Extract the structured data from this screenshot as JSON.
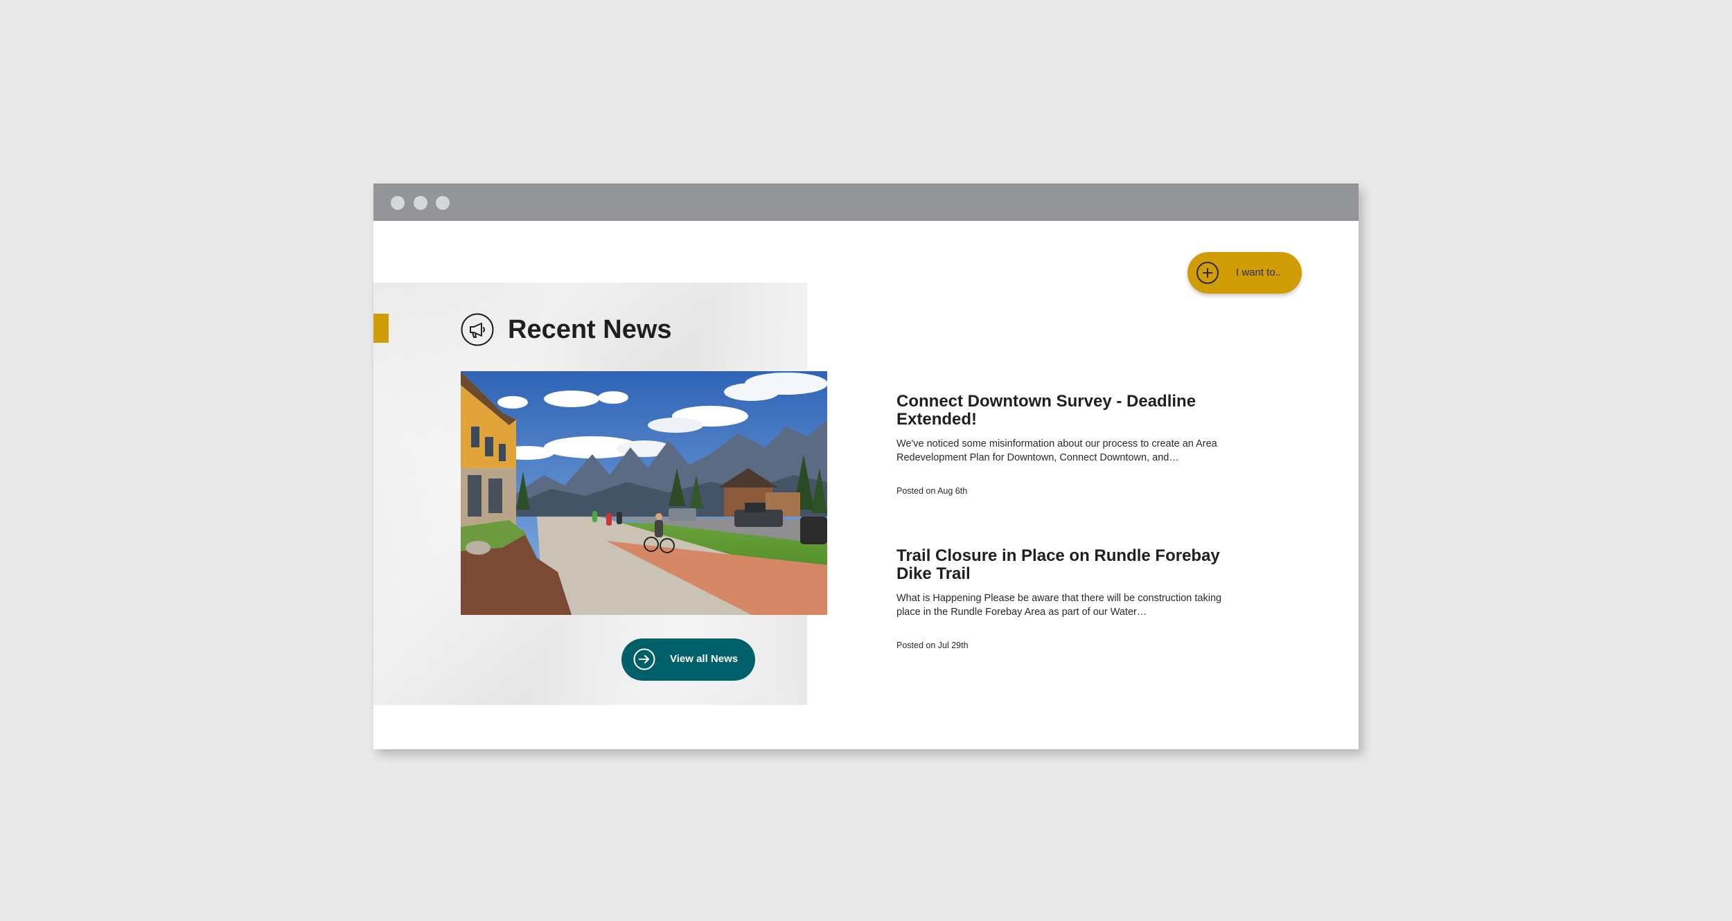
{
  "actions": {
    "want_label": "I want to.."
  },
  "news": {
    "section_title": "Recent News",
    "view_all_label": "View all News",
    "articles": [
      {
        "title": "Connect Downtown Survey - Deadline Extended!",
        "excerpt": "We've noticed some misinformation about our process to create an Area Redevelopment Plan for Downtown, Connect Downtown, and…",
        "date": "Posted on Aug 6th"
      },
      {
        "title": "Trail Closure in Place on Rundle Forebay Dike Trail",
        "excerpt": "What is Happening Please be aware that there will be construction taking place in the Rundle Forebay Area as part of our Water…",
        "date": "Posted on Jul 29th"
      }
    ]
  },
  "colors": {
    "accent": "#d09d06",
    "primary": "#00606a",
    "chrome": "#939598"
  },
  "icons": {
    "megaphone": "megaphone-icon",
    "plus": "plus-circle-icon",
    "arrow": "arrow-right-circle-icon"
  }
}
